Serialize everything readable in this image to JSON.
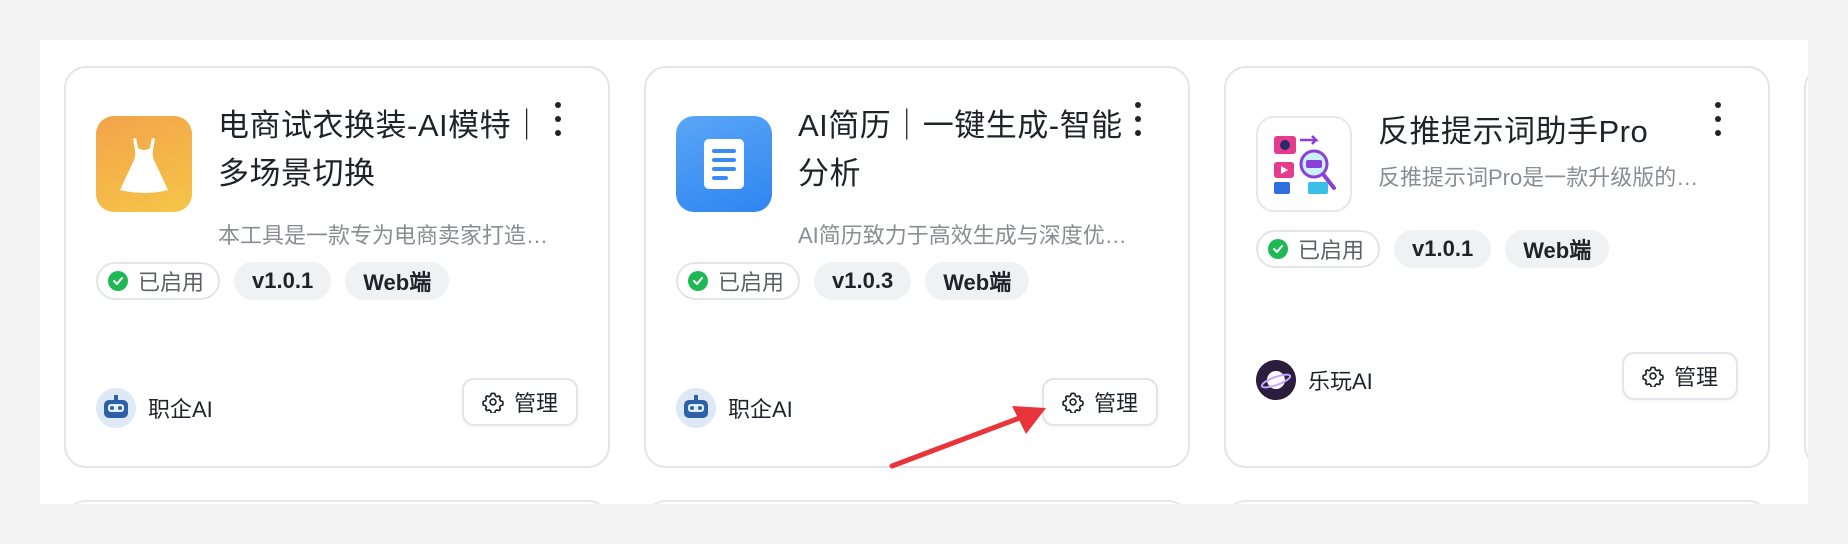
{
  "cards": [
    {
      "title": "电商试衣换装-AI模特｜多场景切换",
      "description": "本工具是一款专为电商卖家打造…",
      "icon": "dress-icon",
      "status": "已启用",
      "version": "v1.0.1",
      "platform": "Web端",
      "author": "职企AI",
      "manage_label": "管理"
    },
    {
      "title": "AI简历｜一键生成-智能分析",
      "description": "AI简历致力于高效生成与深度优…",
      "icon": "document-icon",
      "status": "已启用",
      "version": "v1.0.3",
      "platform": "Web端",
      "author": "职企AI",
      "manage_label": "管理"
    },
    {
      "title": "反推提示词助手Pro",
      "description": "反推提示词Pro是一款升级版的…",
      "icon": "prompt-reverse-icon",
      "status": "已启用",
      "version": "v1.0.1",
      "platform": "Web端",
      "author": "乐玩AI",
      "manage_label": "管理"
    }
  ],
  "colors": {
    "status_green": "#20b857",
    "arrow_red": "#e8343a"
  }
}
